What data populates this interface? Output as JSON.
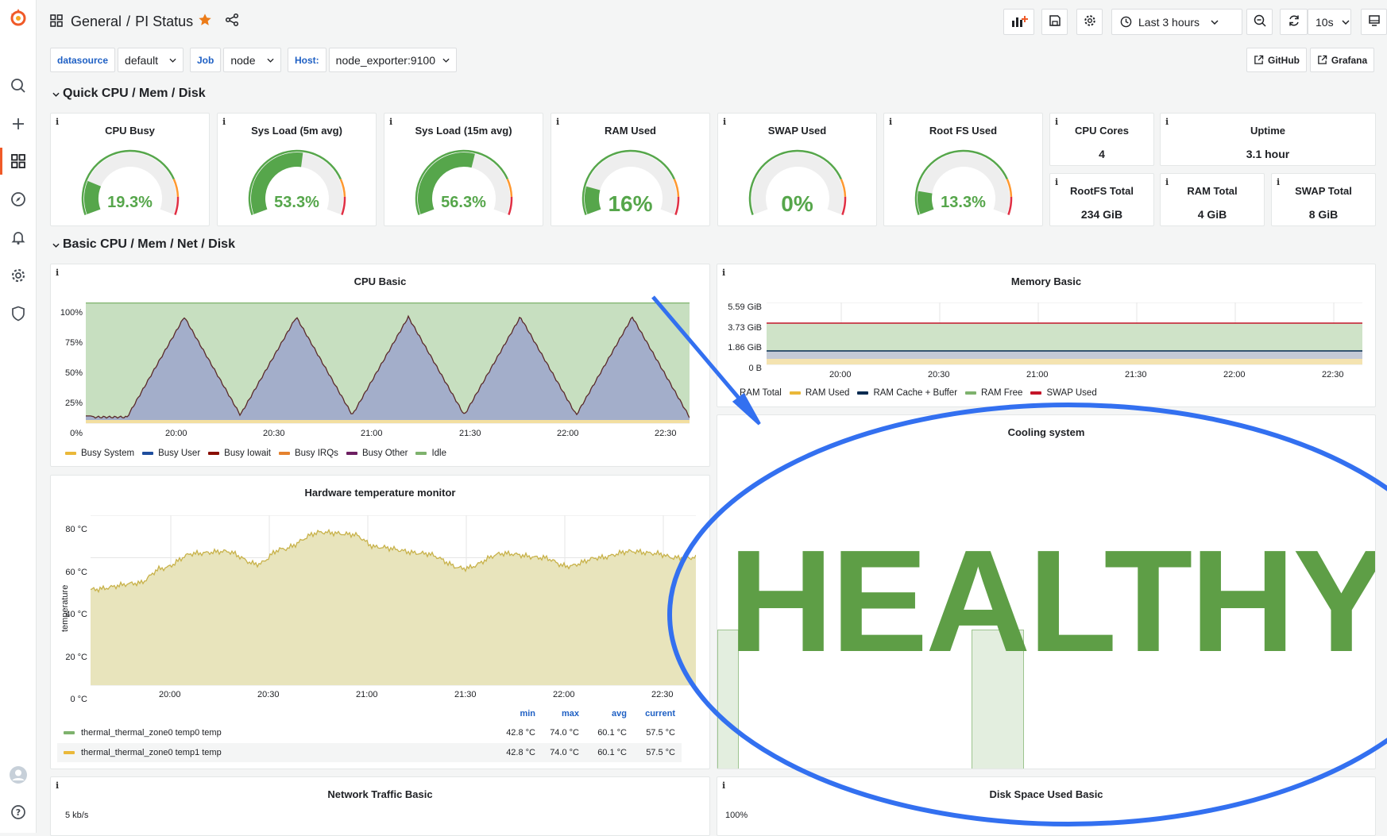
{
  "topbar": {
    "breadcrumb_folder": "General",
    "breadcrumb_sep": "/",
    "dashboard_title": "PI Status",
    "time_range": "Last 3 hours",
    "refresh_interval": "10s"
  },
  "variables": [
    {
      "label": "datasource",
      "value": "default"
    },
    {
      "label": "Job",
      "value": "node"
    },
    {
      "label": "Host:",
      "value": "node_exporter:9100"
    }
  ],
  "links": {
    "github": "GitHub",
    "grafana": "Grafana"
  },
  "rows": {
    "quick": "Quick CPU / Mem / Disk",
    "basic": "Basic CPU / Mem / Net / Disk"
  },
  "gauges": [
    {
      "title": "CPU Busy",
      "value": "19.3%",
      "fraction": 0.193
    },
    {
      "title": "Sys Load (5m avg)",
      "value": "53.3%",
      "fraction": 0.533
    },
    {
      "title": "Sys Load (15m avg)",
      "value": "56.3%",
      "fraction": 0.563
    },
    {
      "title": "RAM Used",
      "value": "16%",
      "fraction": 0.16
    },
    {
      "title": "SWAP Used",
      "value": "0%",
      "fraction": 0.0
    },
    {
      "title": "Root FS Used",
      "value": "13.3%",
      "fraction": 0.133
    }
  ],
  "stats": [
    {
      "title": "CPU Cores",
      "value": "4"
    },
    {
      "title": "Uptime",
      "value": "3.1 hour"
    },
    {
      "title": "RootFS Total",
      "value": "234 GiB"
    },
    {
      "title": "RAM Total",
      "value": "4 GiB"
    },
    {
      "title": "SWAP Total",
      "value": "8 GiB"
    }
  ],
  "cpu_basic": {
    "title": "CPU Basic",
    "yticks": [
      "100%",
      "75%",
      "50%",
      "25%",
      "0%"
    ],
    "xticks": [
      "20:00",
      "20:30",
      "21:00",
      "21:30",
      "22:00",
      "22:30"
    ],
    "legend": [
      {
        "name": "Busy System",
        "color": "#eab839"
      },
      {
        "name": "Busy User",
        "color": "#1f4e9e"
      },
      {
        "name": "Busy Iowait",
        "color": "#890f02"
      },
      {
        "name": "Busy IRQs",
        "color": "#e5822e"
      },
      {
        "name": "Busy Other",
        "color": "#6d1f62"
      },
      {
        "name": "Idle",
        "color": "#7eb26d"
      }
    ]
  },
  "memory_basic": {
    "title": "Memory Basic",
    "yticks": [
      "5.59 GiB",
      "3.73 GiB",
      "1.86 GiB",
      "0 B"
    ],
    "xticks": [
      "20:00",
      "20:30",
      "21:00",
      "21:30",
      "22:00",
      "22:30"
    ],
    "legend": [
      {
        "name": "RAM Total",
        "color": ""
      },
      {
        "name": "RAM Used",
        "color": "#eab839"
      },
      {
        "name": "RAM Cache + Buffer",
        "color": "#052b51"
      },
      {
        "name": "RAM Free",
        "color": "#7eb26d"
      },
      {
        "name": "SWAP Used",
        "color": "#c4162a"
      }
    ]
  },
  "temp_monitor": {
    "title": "Hardware temperature monitor",
    "ylabel": "temperature",
    "yticks": [
      "80 °C",
      "60 °C",
      "40 °C",
      "20 °C",
      "0 °C"
    ],
    "xticks": [
      "20:00",
      "20:30",
      "21:00",
      "21:30",
      "22:00",
      "22:30"
    ],
    "columns": [
      "min",
      "max",
      "avg",
      "current"
    ],
    "rows": [
      {
        "name": "thermal_thermal_zone0 temp0 temp",
        "color": "#7eb26d",
        "min": "42.8 °C",
        "max": "74.0 °C",
        "avg": "60.1 °C",
        "current": "57.5 °C"
      },
      {
        "name": "thermal_thermal_zone0 temp1 temp",
        "color": "#eab839",
        "min": "42.8 °C",
        "max": "74.0 °C",
        "avg": "60.1 °C",
        "current": "57.5 °C"
      }
    ]
  },
  "cooling": {
    "title": "Cooling system",
    "status": "HEALTHY",
    "status_color": "#5e9e46"
  },
  "network": {
    "title": "Network Traffic Basic",
    "ytick_top": "5 kb/s"
  },
  "disk_space": {
    "title": "Disk Space Used Basic",
    "ytick_top": "100%"
  },
  "colors": {
    "accent": "#f05a28",
    "star": "#eb7b18",
    "gauge_green": "#56a64b",
    "annotation_blue": "#3370f0"
  }
}
